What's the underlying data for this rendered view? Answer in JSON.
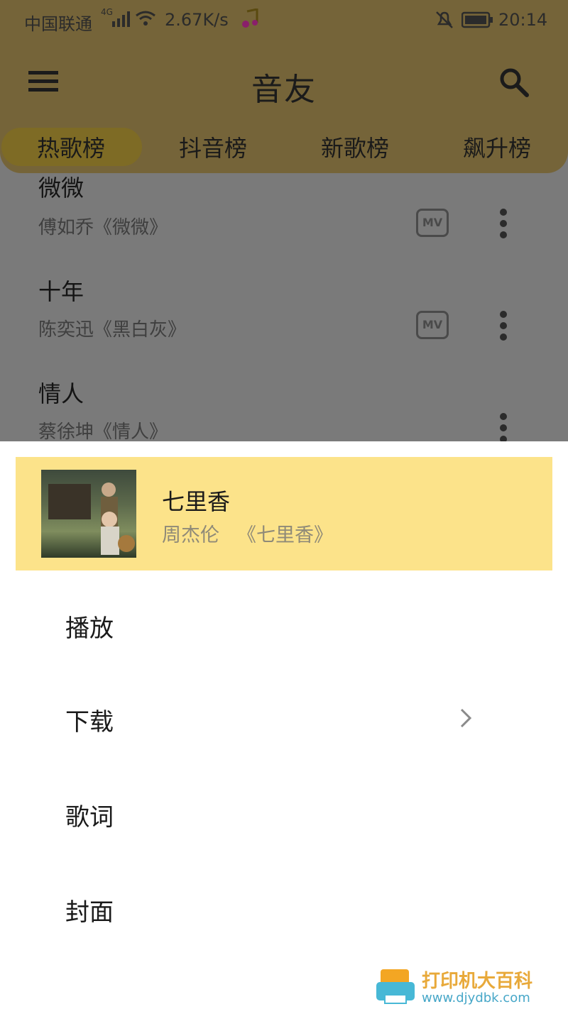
{
  "status_bar": {
    "carrier": "中国联通",
    "network": "4G",
    "speed": "2.67K/s",
    "time": "20:14"
  },
  "header": {
    "title": "音友",
    "menu_icon": "hamburger-menu-icon",
    "search_icon": "search-icon"
  },
  "tabs": [
    {
      "label": "热歌榜",
      "active": true
    },
    {
      "label": "抖音榜",
      "active": false
    },
    {
      "label": "新歌榜",
      "active": false
    },
    {
      "label": "飙升榜",
      "active": false
    }
  ],
  "songs": [
    {
      "title": "微微",
      "subtitle": "傅如乔《微微》",
      "mv": "MV"
    },
    {
      "title": "十年",
      "subtitle": "陈奕迅《黑白灰》",
      "mv": "MV"
    },
    {
      "title": "情人",
      "subtitle": "蔡徐坤《情人》"
    }
  ],
  "sheet": {
    "song_title": "七里香",
    "song_artist": "周杰伦",
    "song_album": "《七里香》",
    "menu": [
      {
        "label": "播放"
      },
      {
        "label": "下载",
        "has_submenu": true
      },
      {
        "label": "歌词"
      },
      {
        "label": "封面"
      }
    ]
  },
  "watermark": {
    "text": "打印机大百科",
    "url": "www.djydbk.com"
  },
  "colors": {
    "accent": "#fce38a",
    "header_dimmed": "#756439",
    "overlay": "#7a7a7a"
  }
}
